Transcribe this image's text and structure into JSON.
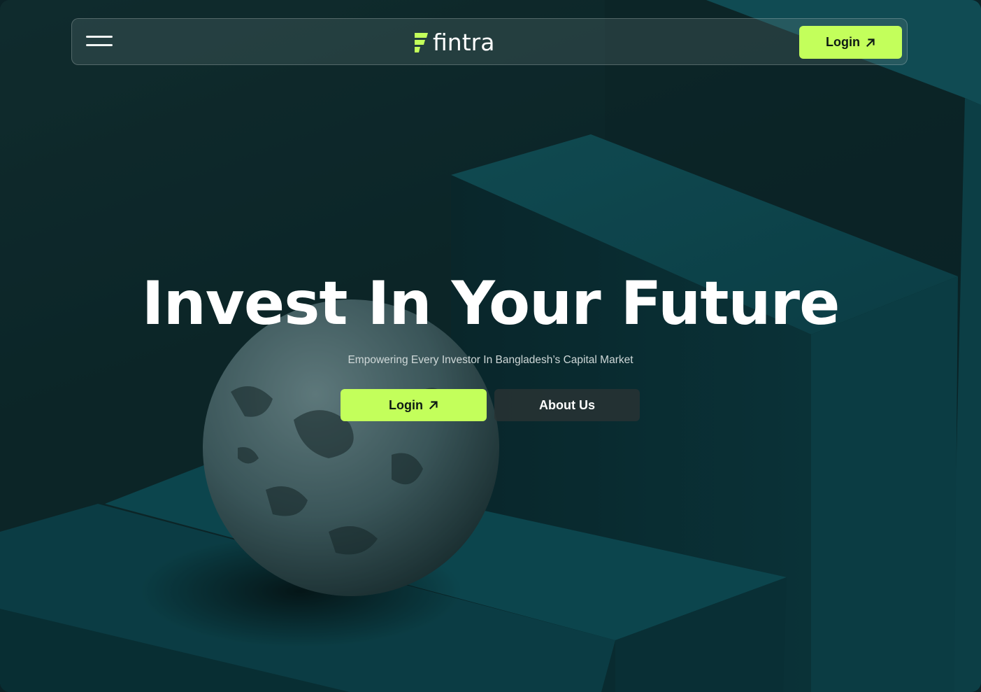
{
  "brand": {
    "name": "fintra",
    "accent": "#c3ff5b"
  },
  "nav": {
    "menu_icon": "hamburger-icon",
    "login_label": "Login",
    "login_icon": "arrow-up-right-icon"
  },
  "hero": {
    "title": "Invest In Your Future",
    "subtitle": "Empowering Every Investor In Bangladesh’s Capital Market",
    "primary_label": "Login",
    "primary_icon": "arrow-up-right-icon",
    "secondary_label": "About Us"
  }
}
